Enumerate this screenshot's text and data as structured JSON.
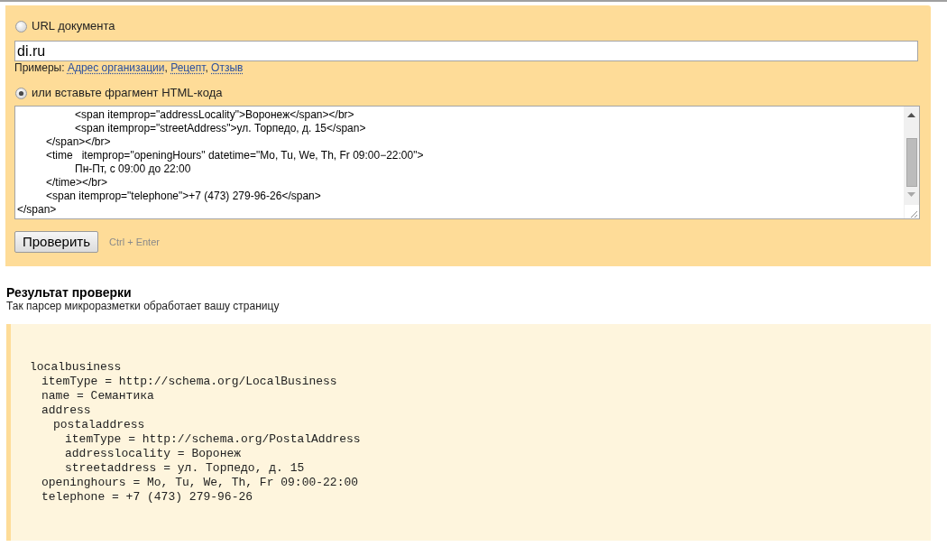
{
  "source_options": [
    {
      "label": "URL документа",
      "selected": false
    },
    {
      "label": "или вставьте фрагмент HTML-кода",
      "selected": true
    }
  ],
  "url_field": {
    "value": "di.ru"
  },
  "examples": {
    "label": "Примеры:",
    "separator": ",",
    "links": [
      "Адрес организации",
      "Рецепт",
      "Отзыв"
    ]
  },
  "html_field": {
    "value": "\t\t<span itemprop=\"addressLocality\">Воронеж</span></br>\n\t\t<span itemprop=\"streetAddress\">ул. Торпедо, д. 15</span>\n\t</span></br>\n\t<time   itemprop=\"openingHours\" datetime=\"Mo, Tu, We, Th, Fr 09:00−22:00\">\n\t\tПн-Пт, с 09:00 до 22:00\n\t</time></br>\n\t<span itemprop=\"telephone\">+7 (473) 279-96-26</span>\n</span>"
  },
  "check_button": {
    "label": "Проверить",
    "shortcut": "Ctrl + Enter"
  },
  "result": {
    "title": "Результат проверки",
    "subtitle": "Так парсер микроразметки обработает вашу страницу",
    "tree": [
      {
        "text": "localbusiness",
        "children": [
          {
            "text": "itemType = http://schema.org/LocalBusiness"
          },
          {
            "text": "name = Семантика"
          },
          {
            "text": "address",
            "children": [
              {
                "text": "postaladdress",
                "children": [
                  {
                    "text": "itemType = http://schema.org/PostalAddress"
                  },
                  {
                    "text": "addresslocality = Воронеж"
                  },
                  {
                    "text": "streetaddress = ул. Торпедо, д. 15"
                  }
                ]
              }
            ]
          },
          {
            "text": "openinghours = Mo, Tu, We, Th, Fr 09:00-22:00"
          },
          {
            "text": "telephone = +7 (473) 279-96-26"
          }
        ]
      }
    ]
  }
}
